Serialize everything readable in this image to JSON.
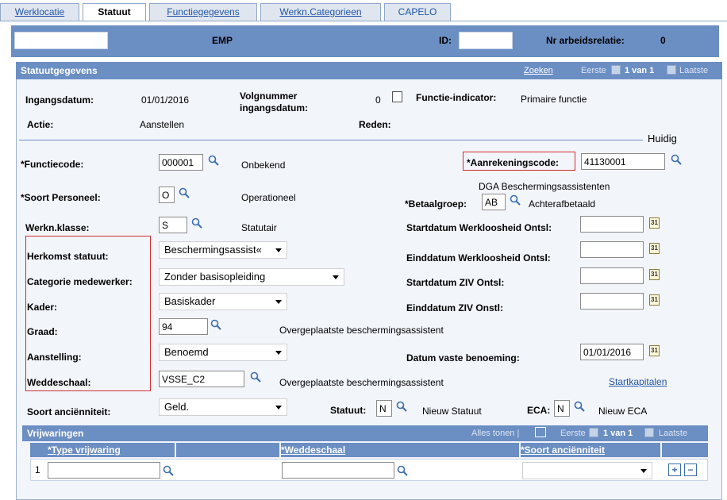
{
  "tabs": [
    "Werklocatie",
    "Statuut",
    "Functiegegevens",
    "Werkn.Categorieen",
    "CAPELO"
  ],
  "header": {
    "name_value": "",
    "role": "EMP",
    "id_label": "ID:",
    "id_value": "",
    "relation_label": "Nr arbeidsrelatie:",
    "relation_value": "0"
  },
  "section": {
    "title": "Statuutgegevens",
    "find_link": "Zoeken",
    "first": "Eerste",
    "count": "1 van 1",
    "last": "Laatste"
  },
  "summary": {
    "ingangsdatum_label": "Ingangsdatum:",
    "ingangsdatum_value": "01/01/2016",
    "volgnummer_label_1": "Volgnummer",
    "volgnummer_label_2": "ingangsdatum:",
    "volgnummer_value": "0",
    "functie_indicator_label": "Functie-indicator:",
    "functie_indicator_value": "Primaire functie",
    "actie_label": "Actie:",
    "actie_value": "Aanstellen",
    "reden_label": "Reden:",
    "status": "Huidig"
  },
  "fields": {
    "functiecode_label": "*Functiecode:",
    "functiecode_value": "000001",
    "functiecode_desc": "Onbekend",
    "aanrekeningscode_label": "*Aanrekeningscode:",
    "aanrekeningscode_value": "41130001",
    "aanrekeningscode_desc": "DGA Beschermingsassistenten",
    "soort_personeel_label": "*Soort Personeel:",
    "soort_personeel_value": "O",
    "soort_personeel_desc": "Operationeel",
    "betaalgroep_label": "*Betaalgroep:",
    "betaalgroep_value": "AB",
    "betaalgroep_desc": "Achterafbetaald",
    "werkn_klasse_label": "Werkn.klasse:",
    "werkn_klasse_value": "S",
    "werkn_klasse_desc": "Statutair",
    "start_werkloosheid_label": "Startdatum Werkloosheid Ontsl:",
    "start_werkloosheid_value": "",
    "herkomst_label": "Herkomst statuut:",
    "herkomst_value": "Beschermingsassist«",
    "eind_werkloosheid_label": "Einddatum Werkloosheid Ontsl:",
    "eind_werkloosheid_value": "",
    "categorie_label": "Categorie medewerker:",
    "categorie_value": "Zonder basisopleiding",
    "start_ziv_label": "Startdatum ZIV Ontsl:",
    "start_ziv_value": "",
    "kader_label": "Kader:",
    "kader_value": "Basiskader",
    "eind_ziv_label": "Einddatum ZIV Onstl:",
    "eind_ziv_value": "",
    "graad_label": "Graad:",
    "graad_value": "94",
    "graad_desc": "Overgeplaatste beschermingsassistent",
    "aanstelling_label": "Aanstelling:",
    "aanstelling_value": "Benoemd",
    "vaste_benoeming_label": "Datum vaste benoeming:",
    "vaste_benoeming_value": "01/01/2016",
    "weddeschaal_label": "Weddeschaal:",
    "weddeschaal_value": "VSSE_C2",
    "weddeschaal_desc": "Overgeplaatste beschermingsassistent",
    "startkapitalen_link": "Startkapitalen",
    "soort_ancien_label": "Soort anciënniteit:",
    "soort_ancien_value": "Geld.",
    "statuut_label": "Statuut:",
    "statuut_value": "N",
    "statuut_desc": "Nieuw Statuut",
    "eca_label": "ECA:",
    "eca_value": "N",
    "eca_desc": "Nieuw ECA"
  },
  "grid": {
    "title": "Vrijwaringen",
    "show_all": "Alles tonen |",
    "first": "Eerste",
    "count": "1 van 1",
    "last": "Laatste",
    "columns": [
      "*Type vrijwaring",
      "*Weddeschaal",
      "*Soort anciënniteit"
    ],
    "row_number": "1",
    "add": "+",
    "remove": "−"
  },
  "colors": {
    "accent": "#6b8ec3",
    "highlight": "#d03030"
  }
}
